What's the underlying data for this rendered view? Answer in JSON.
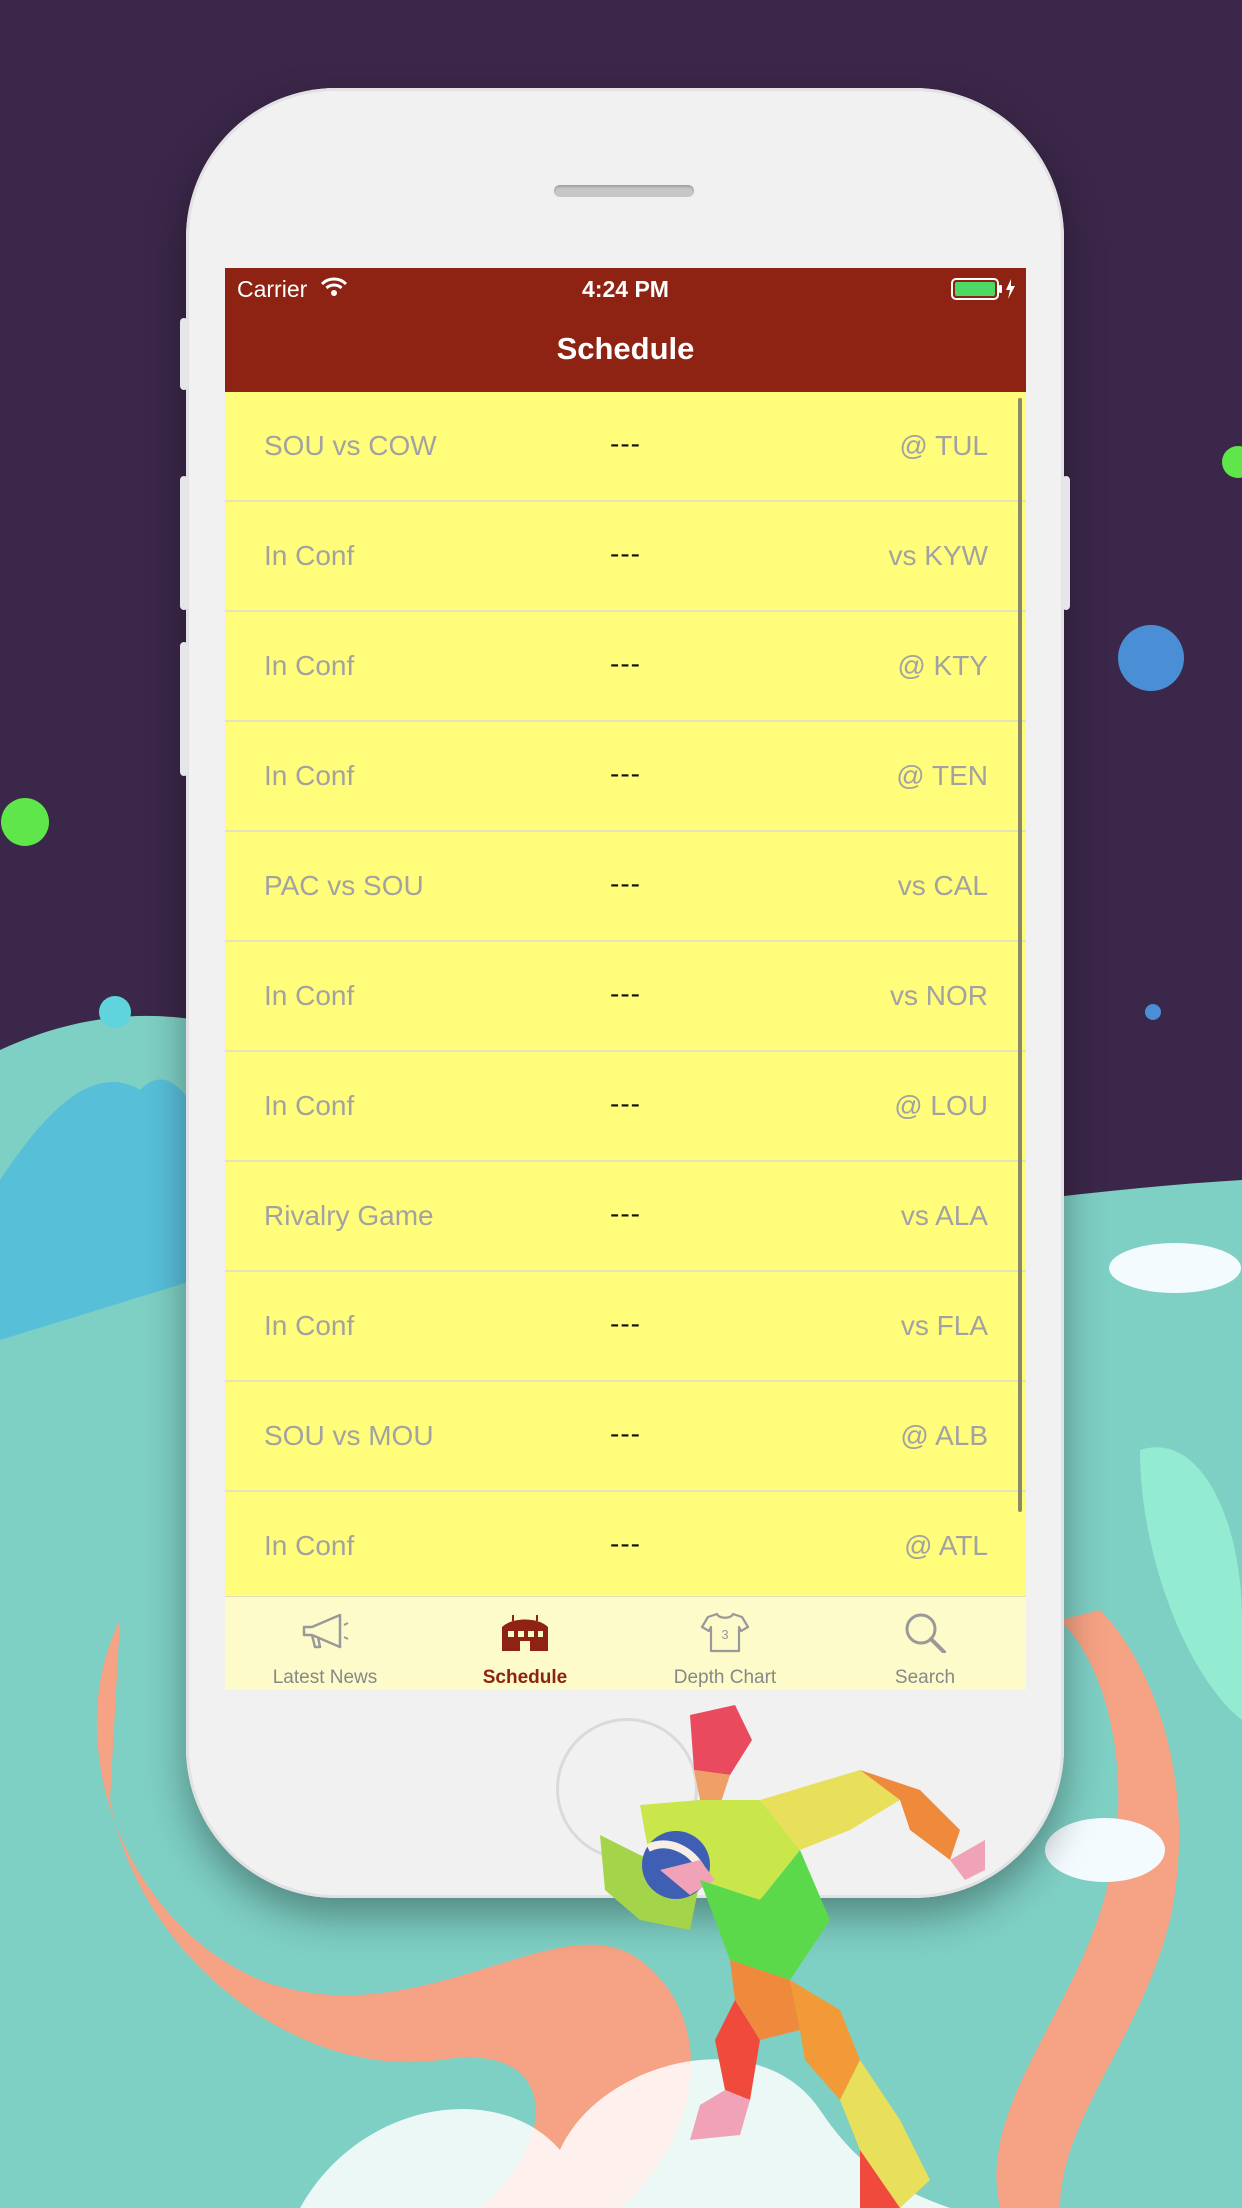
{
  "status_bar": {
    "carrier": "Carrier",
    "time": "4:24 PM"
  },
  "nav": {
    "title": "Schedule"
  },
  "games": [
    {
      "matchup": "SOU vs COW",
      "score": "---",
      "opponent": "@ TUL"
    },
    {
      "matchup": "In Conf",
      "score": "---",
      "opponent": "vs KYW"
    },
    {
      "matchup": "In Conf",
      "score": "---",
      "opponent": "@ KTY"
    },
    {
      "matchup": "In Conf",
      "score": "---",
      "opponent": "@ TEN"
    },
    {
      "matchup": "PAC vs SOU",
      "score": "---",
      "opponent": "vs CAL"
    },
    {
      "matchup": "In Conf",
      "score": "---",
      "opponent": "vs NOR"
    },
    {
      "matchup": "In Conf",
      "score": "---",
      "opponent": "@ LOU"
    },
    {
      "matchup": "Rivalry Game",
      "score": "---",
      "opponent": "vs ALA"
    },
    {
      "matchup": "In Conf",
      "score": "---",
      "opponent": "vs FLA"
    },
    {
      "matchup": "SOU vs MOU",
      "score": "---",
      "opponent": "@ ALB"
    },
    {
      "matchup": "In Conf",
      "score": "---",
      "opponent": "@ ATL"
    }
  ],
  "tabs": [
    {
      "label": "Latest News",
      "icon": "megaphone-icon"
    },
    {
      "label": "Schedule",
      "icon": "stadium-icon"
    },
    {
      "label": "Depth Chart",
      "icon": "jersey-icon"
    },
    {
      "label": "Search",
      "icon": "search-icon"
    }
  ],
  "colors": {
    "nav_bar": "#8e2314",
    "list_background": "#fffd7a",
    "tab_bar": "#fdfbc9",
    "active_tab": "#8e2314"
  }
}
